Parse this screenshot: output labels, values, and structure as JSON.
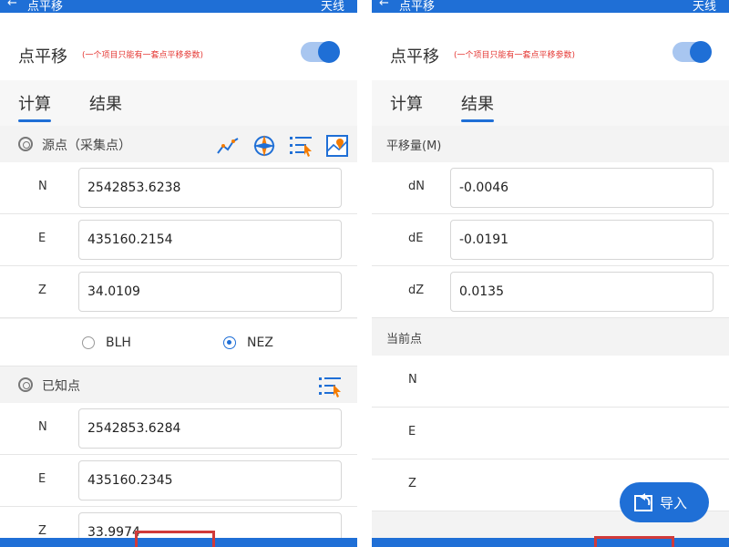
{
  "left": {
    "topbar": {
      "back": "←",
      "title": "点平移",
      "right": "天线"
    },
    "header": {
      "title": "点平移",
      "note": "(一个项目只能有一套点平移参数)"
    },
    "tabs": {
      "calc": "计算",
      "result": "结果",
      "active": "calc"
    },
    "source": {
      "label": "源点（采集点）",
      "fields": [
        {
          "key": "N",
          "value": "2542853.6238"
        },
        {
          "key": "E",
          "value": "435160.2154"
        },
        {
          "key": "Z",
          "value": "34.0109"
        }
      ]
    },
    "coord_mode": {
      "options": [
        "BLH",
        "NEZ"
      ],
      "selected": "NEZ"
    },
    "known": {
      "label": "已知点",
      "fields": [
        {
          "key": "N",
          "value": "2542853.6284"
        },
        {
          "key": "E",
          "value": "435160.2345"
        },
        {
          "key": "Z",
          "value": "33.9974"
        }
      ]
    }
  },
  "right": {
    "topbar": {
      "back": "←",
      "title": "点平移",
      "right": "天线"
    },
    "header": {
      "title": "点平移",
      "note": "(一个项目只能有一套点平移参数)"
    },
    "tabs": {
      "calc": "计算",
      "result": "结果",
      "active": "result"
    },
    "offset": {
      "label": "平移量(M)",
      "fields": [
        {
          "key": "dN",
          "value": "-0.0046"
        },
        {
          "key": "dE",
          "value": "-0.0191"
        },
        {
          "key": "dZ",
          "value": "0.0135"
        }
      ]
    },
    "current": {
      "label": "当前点",
      "fields": [
        {
          "key": "N",
          "value": ""
        },
        {
          "key": "E",
          "value": ""
        },
        {
          "key": "Z",
          "value": ""
        }
      ]
    },
    "import_label": "导入"
  },
  "colors": {
    "primary": "#1f6fd6",
    "accent": "#f57c00",
    "note": "#e53935",
    "highlight": "#d03a3a"
  },
  "icons": [
    "back-arrow-icon",
    "curve-chart-icon",
    "compass-icon",
    "list-pick-icon",
    "map-pick-icon",
    "import-icon",
    "target-icon"
  ]
}
